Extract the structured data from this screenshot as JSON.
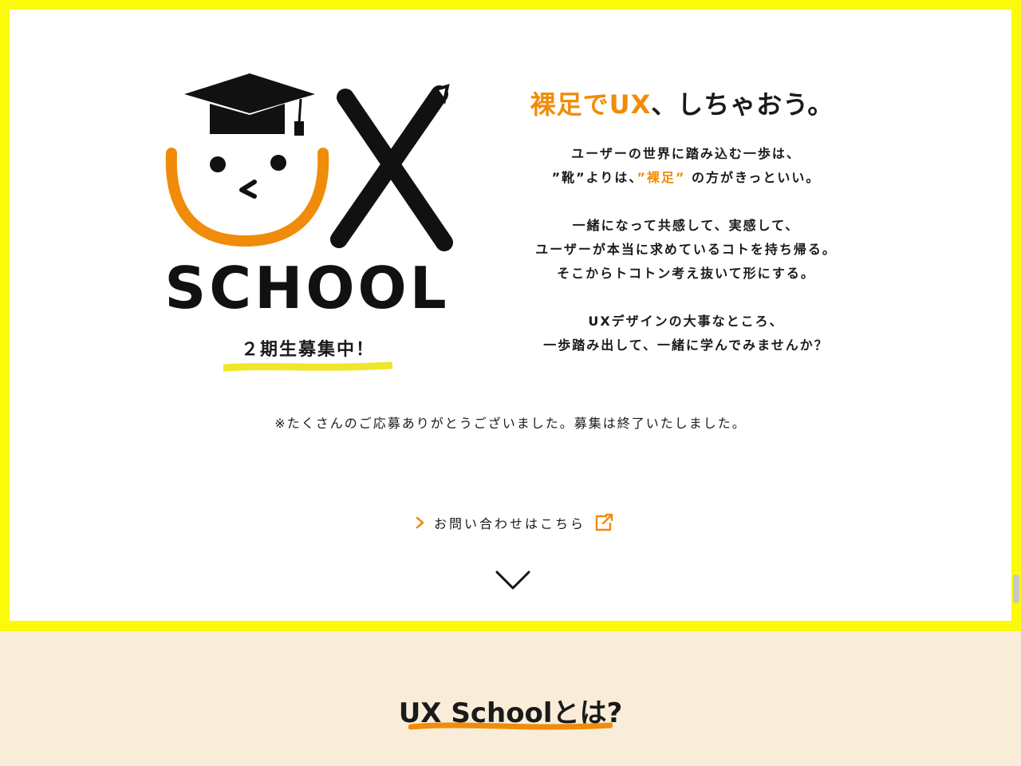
{
  "hero": {
    "logo_text": "SCHOOL",
    "logo_letters": "UX",
    "recruit": "２期生募集中！",
    "headline": {
      "accent": "裸足でUX",
      "rest": "、しちゃおう。"
    },
    "copy": {
      "p1_l1": "ユーザーの世界に踏み込む一歩は、",
      "p1_l2_pre": "”靴”よりは、",
      "p1_l2_accent": "”裸足”",
      "p1_l2_post": " の方がきっといい。",
      "p2_l1": "一緒になって共感して、実感して、",
      "p2_l2": "ユーザーが本当に求めているコトを持ち帰る。",
      "p2_l3": "そこからトコトン考え抜いて形にする。",
      "p3_l1": "UXデザインの大事なところ、",
      "p3_l2": "一歩踏み出して、一緒に学んでみませんか？"
    },
    "closed_notice": "※たくさんのご応募ありがとうございました。募集は終了いたしました。",
    "contact_label": "お問い合わせはこちら"
  },
  "about": {
    "title": "UX Schoolとは?"
  },
  "colors": {
    "frame_yellow": "#fafa0a",
    "accent_orange": "#f08c0a",
    "section_bg": "#f9edd9",
    "text": "#1a1a1a"
  },
  "icons": [
    "graduation-cap-icon",
    "chevron-right-icon",
    "external-link-icon",
    "chevron-down-icon"
  ]
}
